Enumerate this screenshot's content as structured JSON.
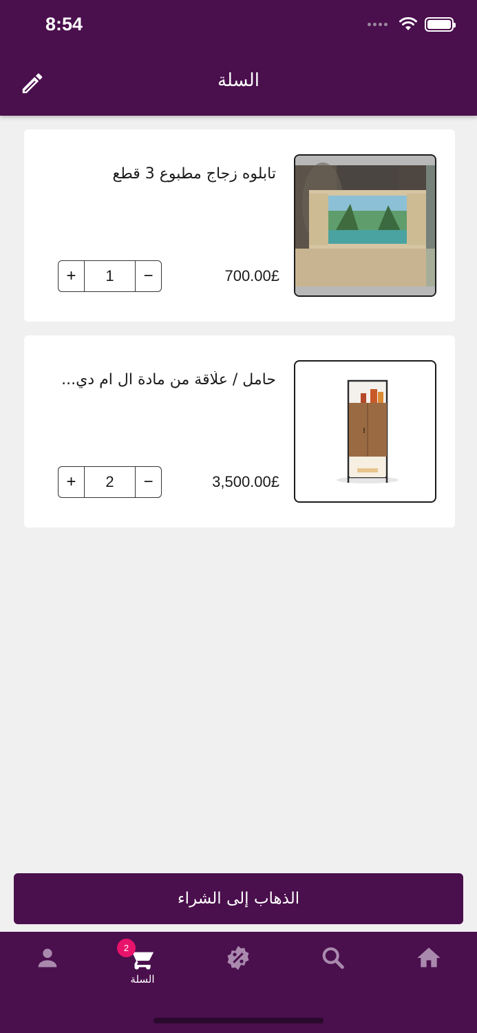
{
  "status_bar": {
    "time": "8:54"
  },
  "header": {
    "title": "السلة"
  },
  "cart_items": [
    {
      "name": "تابلوه زجاج مطبوع 3 قطع",
      "price": "700.00£",
      "quantity": "1",
      "plus": "+",
      "minus": "−"
    },
    {
      "name": "حامل / علّاقة من مادة ال ام دي...",
      "price": "3,500.00£",
      "quantity": "2",
      "plus": "+",
      "minus": "−"
    }
  ],
  "checkout": {
    "label": "الذهاب إلى الشراء"
  },
  "bottom_nav": {
    "cart_label": "السلة",
    "cart_badge": "2",
    "items": [
      "profile-icon",
      "cart-icon",
      "discount-icon",
      "search-icon",
      "home-icon"
    ]
  },
  "colors": {
    "primary": "#4a0f4d",
    "badge": "#e8136b",
    "background": "#f0f0f0"
  }
}
